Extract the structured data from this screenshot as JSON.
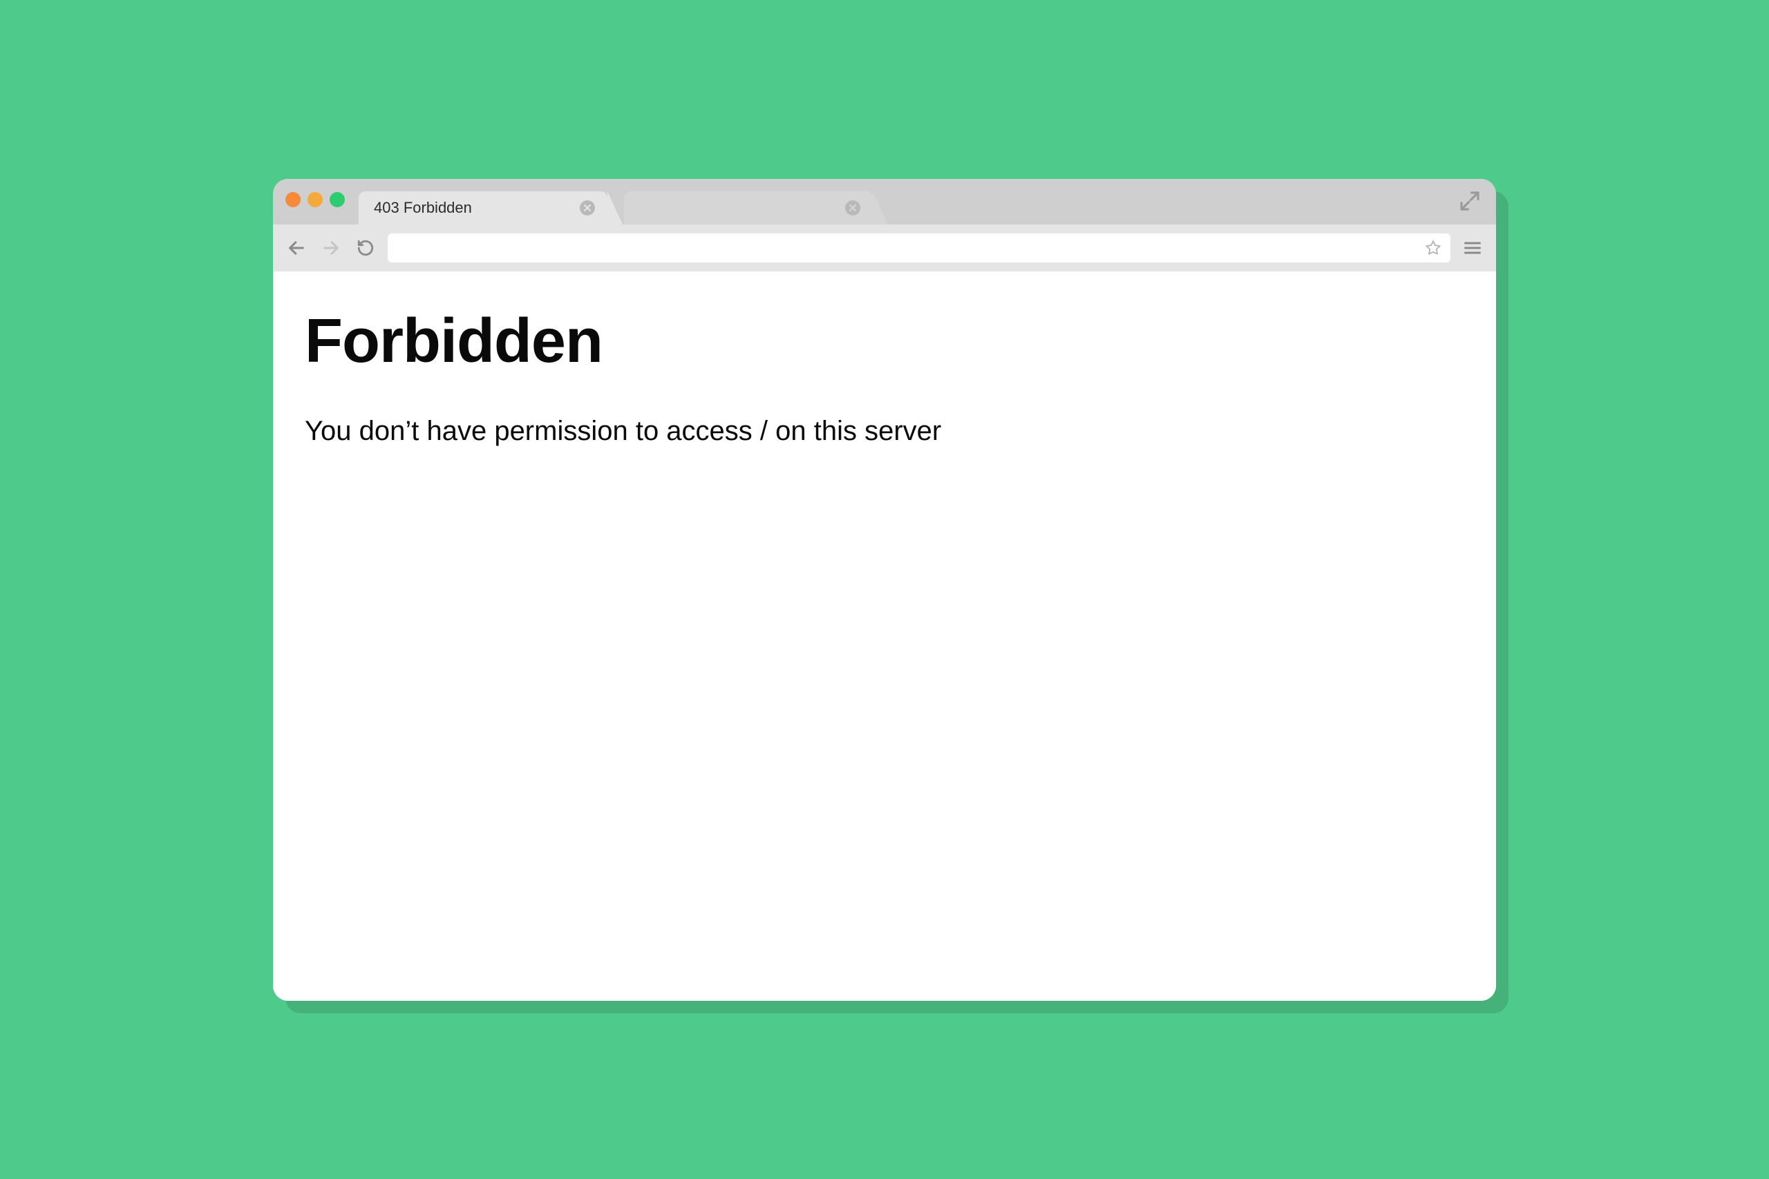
{
  "window": {
    "traffic_light_colors": [
      "#F58A3C",
      "#F5A93C",
      "#2ECC71"
    ]
  },
  "tabs": {
    "active": {
      "title": "403 Forbidden"
    },
    "inactive": {
      "title": ""
    }
  },
  "toolbar": {
    "address_value": ""
  },
  "page": {
    "heading": "Forbidden",
    "message": "You don’t have permission to access / on this server"
  }
}
